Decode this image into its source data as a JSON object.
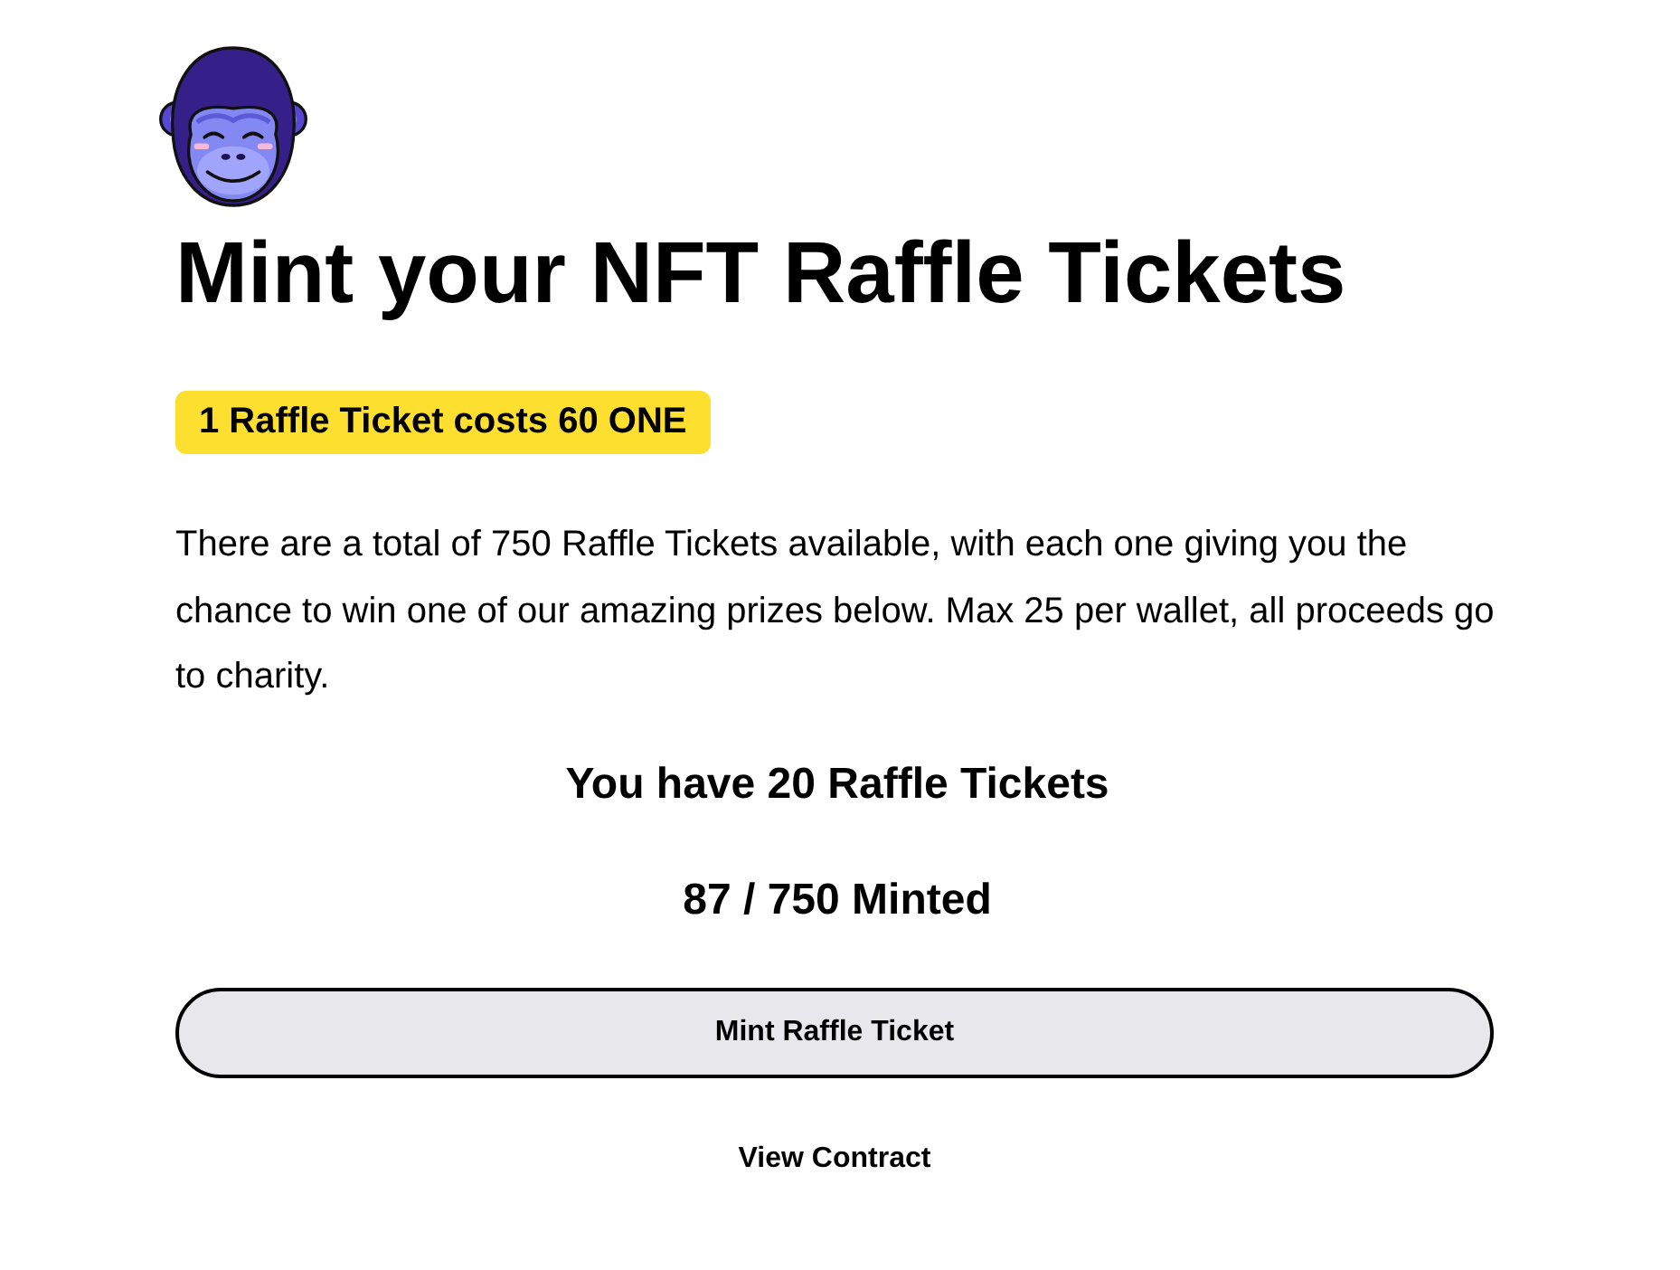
{
  "header": {
    "title": "Mint your NFT Raffle Tickets"
  },
  "price_badge": {
    "label": "1 Raffle Ticket costs 60 ONE"
  },
  "description": "There are a total of 750 Raffle Tickets available, with each one giving you the chance to win one of our amazing prizes below. Max 25 per wallet, all proceeds go to charity.",
  "ticket_count": "You have 20 Raffle Tickets",
  "minted_count": "87 / 750 Minted",
  "mint_button": {
    "label": "Mint Raffle Ticket"
  },
  "contract_link": {
    "label": "View Contract"
  }
}
